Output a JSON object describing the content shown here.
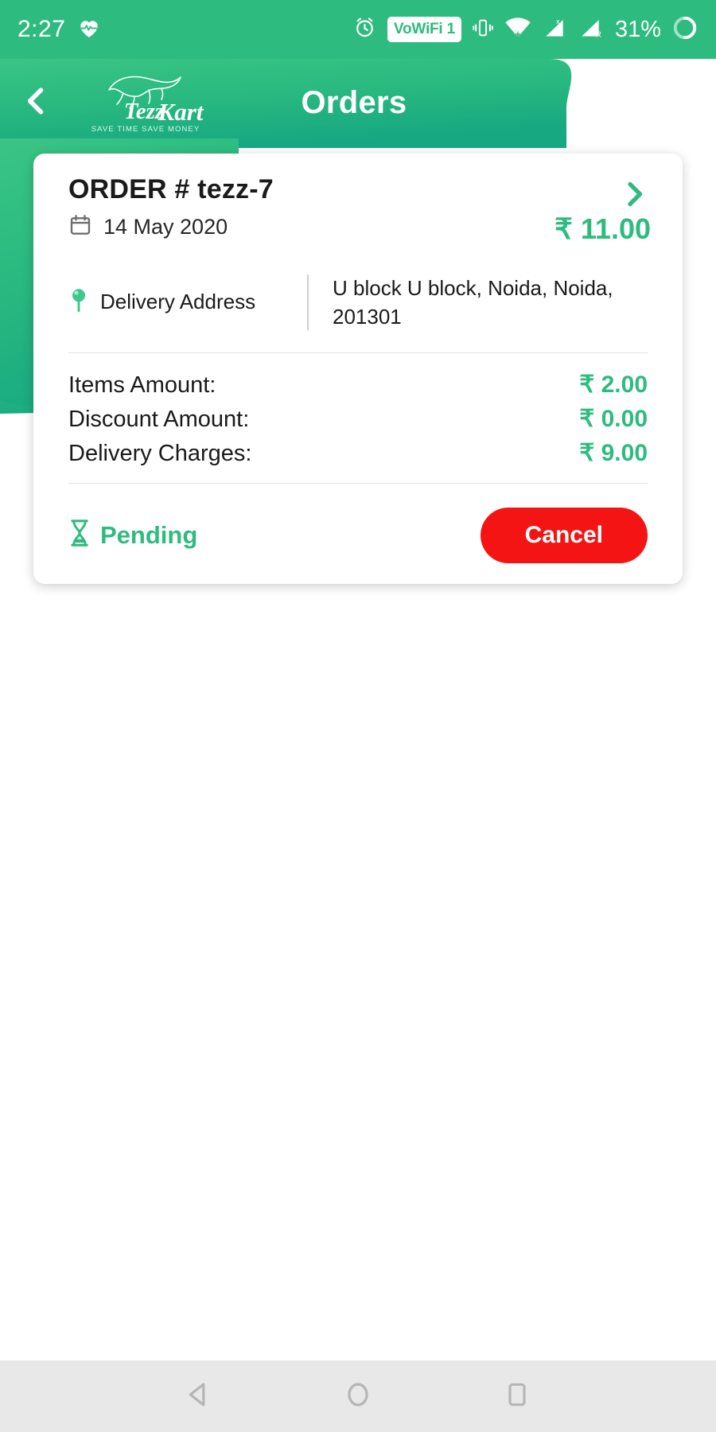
{
  "status_bar": {
    "time": "2:27",
    "battery": "31%",
    "icons": [
      "heart-pulse-icon",
      "alarm-icon",
      "vowifi-badge",
      "vibrate-icon",
      "wifi-icon",
      "signal-sim1-icon",
      "signal-sim2-icon",
      "battery-circle-icon"
    ],
    "vowifi_label": "VoWiFi 1"
  },
  "header": {
    "title": "Orders",
    "back_icon": "chevron-left-icon",
    "logo_name": "TezzKart",
    "logo_tagline": "SAVE TIME  SAVE MONEY",
    "brand_color": "#2ebb7f"
  },
  "order_card": {
    "order_id": "ORDER # tezz-7",
    "date": "14 May 2020",
    "date_icon": "calendar-icon",
    "total": "₹ 11.00",
    "detail_arrow_icon": "chevron-right-icon",
    "address": {
      "label": "Delivery Address",
      "icon": "location-pin-icon",
      "value": "U block U block, Noida, Noida, 201301"
    },
    "amounts": [
      {
        "label": "Items Amount:",
        "value": "₹ 2.00"
      },
      {
        "label": "Discount Amount:",
        "value": "₹ 0.00"
      },
      {
        "label": "Delivery Charges:",
        "value": "₹ 9.00"
      }
    ],
    "status": {
      "text": "Pending",
      "icon": "hourglass-icon",
      "color": "#2ebb7f"
    },
    "cancel_label": "Cancel",
    "cancel_color": "#f41414"
  },
  "nav_bar": {
    "back": "back-triangle-icon",
    "home": "home-circle-icon",
    "recents": "recents-square-icon"
  }
}
